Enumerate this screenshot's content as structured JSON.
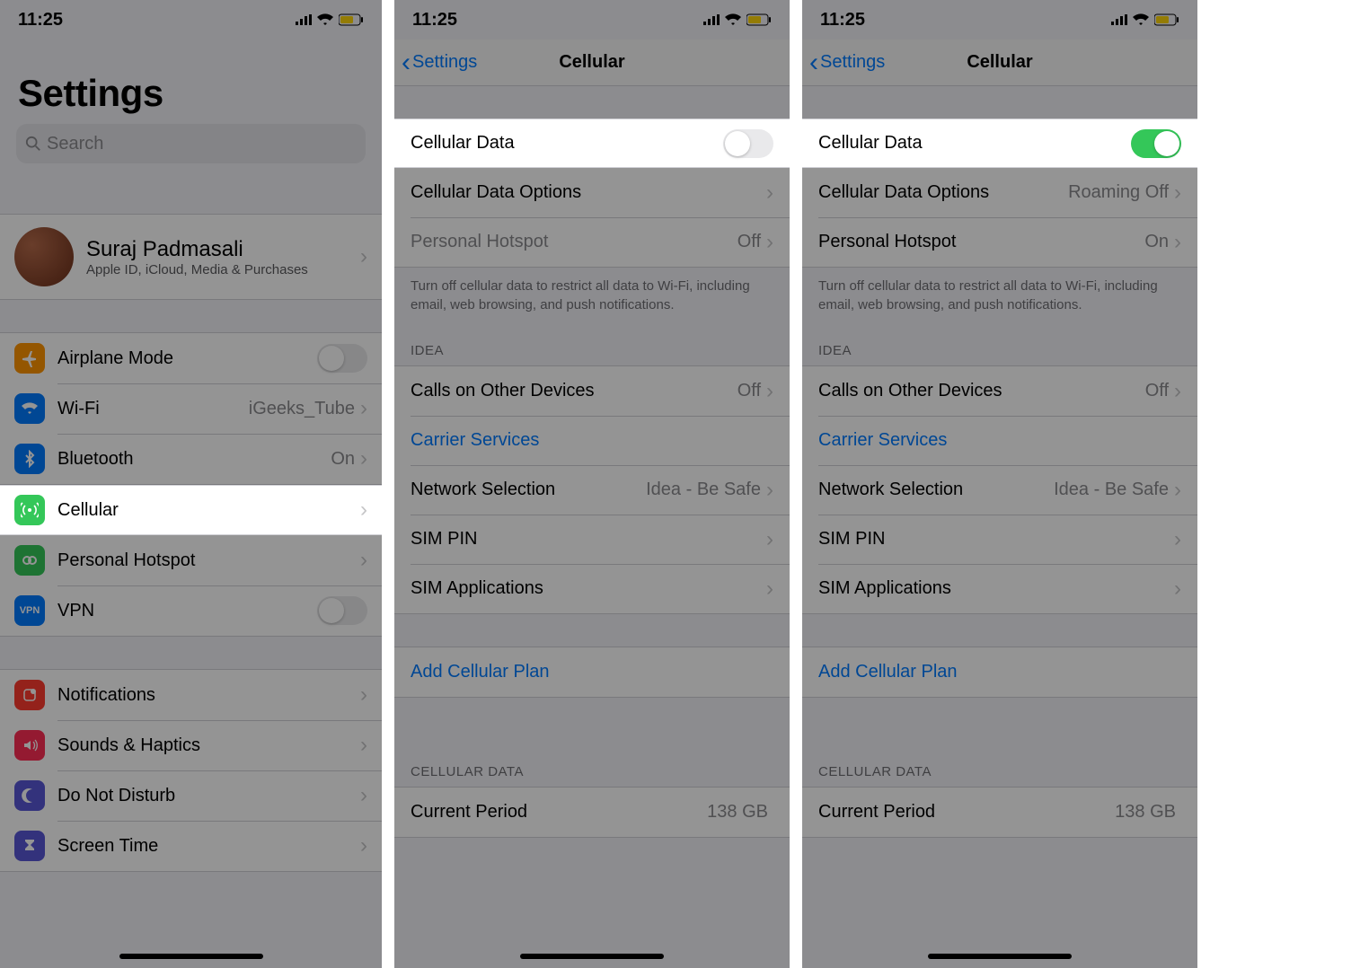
{
  "status": {
    "time": "11:25"
  },
  "screenA": {
    "title": "Settings",
    "searchPlaceholder": "Search",
    "profile": {
      "name": "Suraj Padmasali",
      "sub": "Apple ID, iCloud, Media & Purchases"
    },
    "rows1": {
      "airplane": "Airplane Mode",
      "wifi": "Wi-Fi",
      "wifiValue": "iGeeks_Tube",
      "bluetooth": "Bluetooth",
      "bluetoothValue": "On",
      "cellular": "Cellular",
      "hotspot": "Personal Hotspot",
      "vpn": "VPN"
    },
    "rows2": {
      "notifications": "Notifications",
      "sounds": "Sounds & Haptics",
      "dnd": "Do Not Disturb",
      "screenTime": "Screen Time"
    }
  },
  "screenB": {
    "back": "Settings",
    "title": "Cellular",
    "cellularData": "Cellular Data",
    "options": "Cellular Data Options",
    "hotspot": "Personal Hotspot",
    "hotspotValue": "Off",
    "footer": "Turn off cellular data to restrict all data to Wi-Fi, including email, web browsing, and push notifications.",
    "carrierHeader": "IDEA",
    "calls": "Calls on Other Devices",
    "callsValue": "Off",
    "carrierServices": "Carrier Services",
    "network": "Network Selection",
    "networkValue": "Idea - Be Safe",
    "simpin": "SIM PIN",
    "simapps": "SIM Applications",
    "addPlan": "Add Cellular Plan",
    "dataHeader": "CELLULAR DATA",
    "currentPeriod": "Current Period",
    "currentPeriodValue": "138 GB"
  },
  "screenC": {
    "back": "Settings",
    "title": "Cellular",
    "cellularData": "Cellular Data",
    "options": "Cellular Data Options",
    "optionsValue": "Roaming Off",
    "hotspot": "Personal Hotspot",
    "hotspotValue": "On",
    "footer": "Turn off cellular data to restrict all data to Wi-Fi, including email, web browsing, and push notifications.",
    "carrierHeader": "IDEA",
    "calls": "Calls on Other Devices",
    "callsValue": "Off",
    "carrierServices": "Carrier Services",
    "network": "Network Selection",
    "networkValue": "Idea - Be Safe",
    "simpin": "SIM PIN",
    "simapps": "SIM Applications",
    "addPlan": "Add Cellular Plan",
    "dataHeader": "CELLULAR DATA",
    "currentPeriod": "Current Period",
    "currentPeriodValue": "138 GB"
  }
}
